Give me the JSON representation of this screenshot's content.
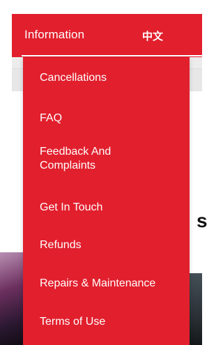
{
  "header": {
    "title": "Information",
    "language": "中文"
  },
  "menu": {
    "items": [
      {
        "label": "Cancellations"
      },
      {
        "label": "FAQ"
      },
      {
        "label": "Feedback And",
        "label2": "Complaints"
      },
      {
        "label": "Get In Touch"
      },
      {
        "label": "Refunds"
      },
      {
        "label": "Repairs & Maintenance"
      },
      {
        "label": "Terms of Use"
      }
    ]
  },
  "background": {
    "partial_letter": "s"
  },
  "colors": {
    "accent": "#e21f2d",
    "text_on_accent": "#ffffff"
  }
}
